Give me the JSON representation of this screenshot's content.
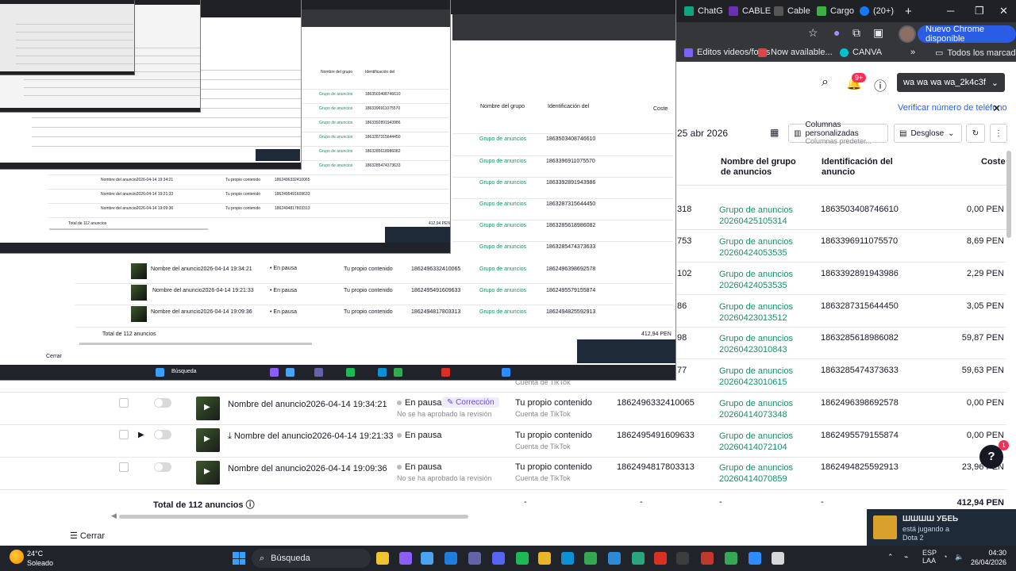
{
  "browser": {
    "tabs": [
      {
        "label": "ChatG",
        "color": "#10a37f"
      },
      {
        "label": "CABLE",
        "color": "#6b2fb3"
      },
      {
        "label": "Cable",
        "color": "#555555"
      },
      {
        "label": "Cargo",
        "color": "#3cb043"
      },
      {
        "label": "(20+)",
        "color": "#1877f2"
      }
    ],
    "new_tab": "+",
    "profile_pill": "Nuevo Chrome disponible",
    "bookmarks": [
      {
        "label": "Editos videos/fotos",
        "color": "#7b61ff"
      },
      {
        "label": "Now available...",
        "color": "#d44"
      },
      {
        "label": "CANVA",
        "color": "#00c4cc"
      }
    ],
    "bookmarks_more": "»",
    "all_bookmarks": "Todos los marcadores"
  },
  "header": {
    "notification_count": "9+",
    "account": "wa wa wa wa_2k4c3f",
    "verify_phone": "Verificar número de teléfono"
  },
  "filters": {
    "date_end": "25 abr 2026",
    "columns_label": "Columnas personalizadas",
    "columns_sub": "Columnas predeter...",
    "breakdown_label": "Desglose"
  },
  "table": {
    "headers": {
      "ad_group_name": "Nombre del grupo de anuncios",
      "ad_id": "Identificación del anuncio",
      "cost": "Coste"
    },
    "upper_rows": [
      {
        "prefix": "318",
        "group": "Grupo de anuncios 20260425105314",
        "id": "1863503408746610",
        "cost": "0,00 PEN"
      },
      {
        "prefix": "753",
        "group": "Grupo de anuncios 20260424053535",
        "id": "1863396911075570",
        "cost": "8,69 PEN"
      },
      {
        "prefix": "102",
        "group": "Grupo de anuncios 20260424053535",
        "id": "1863392891943986",
        "cost": "2,29 PEN"
      },
      {
        "prefix": "86",
        "group": "Grupo de anuncios 20260423013512",
        "id": "1863287315644450",
        "cost": "3,05 PEN"
      },
      {
        "prefix": "98",
        "group": "Grupo de anuncios 20260423010843",
        "id": "1863285618986082",
        "cost": "59,87 PEN"
      },
      {
        "prefix": "77",
        "group": "Grupo de anuncios 20260423010615",
        "id": "1863285474373633",
        "cost": "59,63 PEN"
      }
    ],
    "partial_row": {
      "source": "Cuenta de TikTok"
    },
    "lower_rows": [
      {
        "name": "Nombre del anuncio2026-04-14 19:34:21",
        "status": "En pausa",
        "status_note": "No se ha aprobado la revisión",
        "badge": "Corrección",
        "source": "Tu propio contenido",
        "source_sub": "Cuenta de TikTok",
        "ad_id": "1862496332410065",
        "group": "Grupo de anuncios 20260414073348",
        "group_id": "1862496398692578",
        "cost": "0,00 PEN"
      },
      {
        "name": "Nombre del anuncio2026-04-14 19:21:33",
        "status": "En pausa",
        "status_note": "",
        "badge": "",
        "source": "Tu propio contenido",
        "source_sub": "Cuenta de TikTok",
        "ad_id": "1862495491609633",
        "group": "Grupo de anuncios 20260414072104",
        "group_id": "1862495579155874",
        "cost": "0,00 PEN"
      },
      {
        "name": "Nombre del anuncio2026-04-14 19:09:36",
        "status": "En pausa",
        "status_note": "No se ha aprobado la revisión",
        "badge": "",
        "source": "Tu propio contenido",
        "source_sub": "Cuenta de TikTok",
        "ad_id": "1862494817803313",
        "group": "Grupo de anuncios 20260414070859",
        "group_id": "1862494825592913",
        "cost": "23,96 PEN"
      }
    ],
    "total_label": "Total de 112 anuncios",
    "total_dashes": [
      "-",
      "-",
      "-",
      "-"
    ],
    "total_cost": "412,94 PEN"
  },
  "footer": {
    "close_label": "Cerrar"
  },
  "help": {
    "icon": "?",
    "badge": "1"
  },
  "toast": {
    "name": "ШШШШ УБЕЬ",
    "line1": "está jugando a",
    "line2": "Dota 2"
  },
  "taskbar": {
    "weather_temp": "24°C",
    "weather_desc": "Soleado",
    "search": "Búsqueda",
    "lang1": "ESP",
    "lang2": "LAA",
    "time": "04:30",
    "date": "26/04/2026",
    "apps": [
      {
        "name": "file-explorer-icon",
        "color": "#f2c230"
      },
      {
        "name": "copilot-icon",
        "color": "#8e5cf7"
      },
      {
        "name": "store-icon",
        "color": "#4aa3f0"
      },
      {
        "name": "mail-icon",
        "color": "#1f7de0"
      },
      {
        "name": "teams-icon",
        "color": "#6264a7"
      },
      {
        "name": "discord-icon",
        "color": "#5865f2"
      },
      {
        "name": "spotify-icon",
        "color": "#1db954"
      },
      {
        "name": "folder-icon",
        "color": "#e9b52d"
      },
      {
        "name": "edge-icon",
        "color": "#0f8fd6"
      },
      {
        "name": "chrome-icon",
        "color": "#34a853"
      },
      {
        "name": "vscode-icon",
        "color": "#2d8ad9"
      },
      {
        "name": "edge-dev-icon",
        "color": "#29a67a"
      },
      {
        "name": "app-red-icon",
        "color": "#d93025"
      },
      {
        "name": "obs-icon",
        "color": "#3d3d3d"
      },
      {
        "name": "calculator-icon",
        "color": "#c0392b"
      },
      {
        "name": "chrome-2-icon",
        "color": "#34a853"
      },
      {
        "name": "zoom-icon",
        "color": "#2d8cff"
      },
      {
        "name": "notepad-icon",
        "color": "#d7d7d7"
      }
    ]
  }
}
